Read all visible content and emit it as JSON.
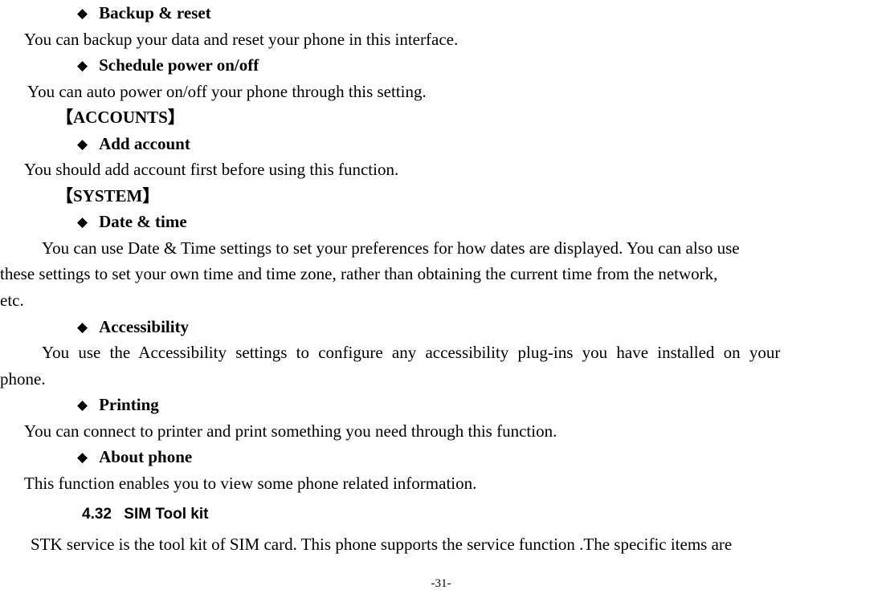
{
  "items": [
    {
      "label": "Backup & reset",
      "desc": "You can backup your data and reset your phone in this interface."
    },
    {
      "label": "Schedule power on/off",
      "desc": "You can auto power on/off your phone through this setting."
    }
  ],
  "accounts_header": "【ACCOUNTS】",
  "accounts_item": {
    "label": "Add account",
    "desc": "You should add account first before using this function."
  },
  "system_header": "【SYSTEM】",
  "system_items": [
    {
      "label": "Date & time",
      "desc_line1": "You can use Date & Time settings to set your preferences for how dates are displayed. You can also use",
      "desc_line2": "these settings to set your own time and time zone, rather than obtaining the current time from the network,",
      "desc_line3": "etc."
    },
    {
      "label": "Accessibility",
      "desc_line1": "You use the Accessibility settings to configure any accessibility plug-ins you have installed on your",
      "desc_line2": "phone."
    },
    {
      "label": "Printing",
      "desc": "You can connect to printer and print something you need through this function."
    },
    {
      "label": "About phone",
      "desc": "This function enables you to view some phone related information."
    }
  ],
  "heading": {
    "num": "4.32",
    "title": "SIM Tool kit"
  },
  "stk_text": "STK service is the tool kit of SIM card. This phone supports the service function .The specific items are",
  "page_number": "-31-"
}
